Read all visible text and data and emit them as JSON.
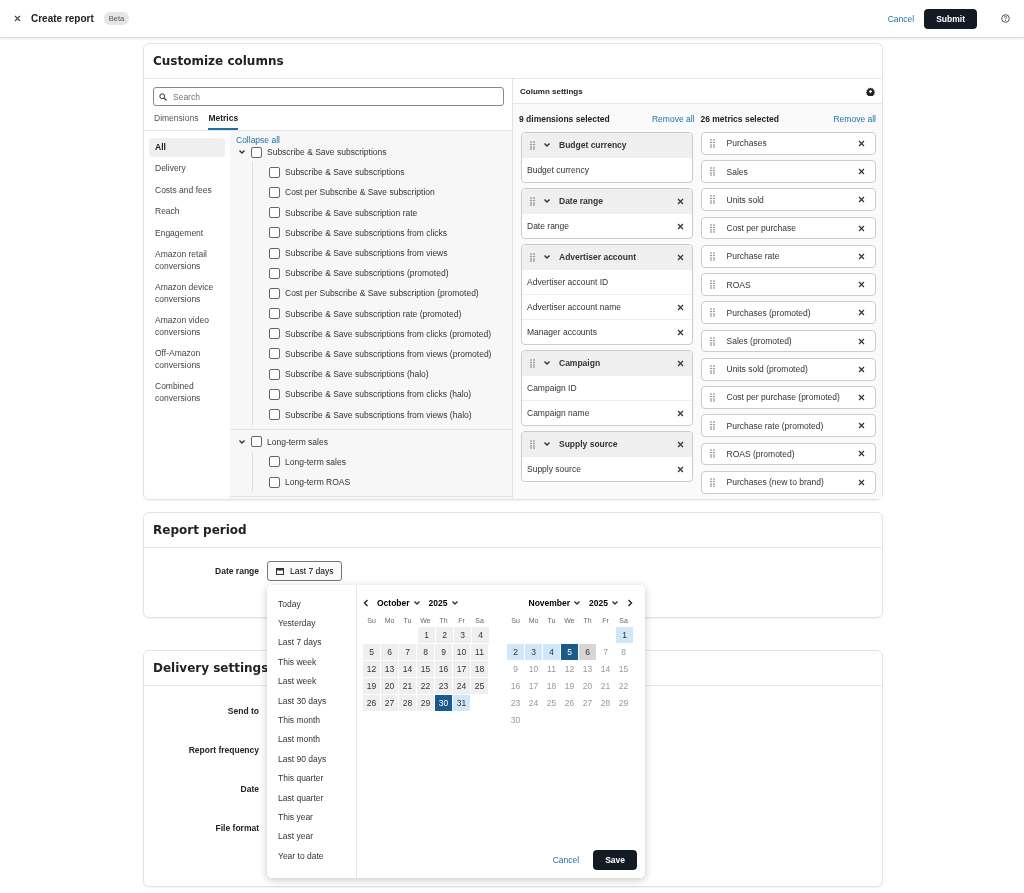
{
  "header": {
    "title": "Create report",
    "badge": "Beta",
    "cancel": "Cancel",
    "submit": "Submit"
  },
  "customize": {
    "title": "Customize columns",
    "search": {
      "placeholder": "Search"
    },
    "tabs": [
      {
        "label": "Dimensions",
        "selected": false
      },
      {
        "label": "Metrics",
        "selected": true
      }
    ],
    "nav": [
      {
        "label": "All",
        "selected": true
      },
      {
        "label": "Delivery",
        "selected": false
      },
      {
        "label": "Costs and fees",
        "selected": false
      },
      {
        "label": "Reach",
        "selected": false
      },
      {
        "label": "Engagement",
        "selected": false
      },
      {
        "label": "Amazon retail conversions",
        "selected": false
      },
      {
        "label": "Amazon device conversions",
        "selected": false
      },
      {
        "label": "Amazon video conversions",
        "selected": false
      },
      {
        "label": "Off-Amazon conversions",
        "selected": false
      },
      {
        "label": "Combined conversions",
        "selected": false
      }
    ],
    "collapse_all": "Collapse all",
    "groups": [
      {
        "label": "Subscribe & Save subscriptions",
        "expanded": true,
        "checked": false,
        "children": [
          {
            "label": "Subscribe & Save subscriptions",
            "checked": false
          },
          {
            "label": "Cost per Subscribe & Save subscription",
            "checked": false
          },
          {
            "label": "Subscribe & Save subscription rate",
            "checked": false
          },
          {
            "label": "Subscribe & Save subscriptions from clicks",
            "checked": false
          },
          {
            "label": "Subscribe & Save subscriptions from views",
            "checked": false
          },
          {
            "label": "Subscribe & Save subscriptions (promoted)",
            "checked": false
          },
          {
            "label": "Cost per Subscribe & Save subscription (promoted)",
            "checked": false
          },
          {
            "label": "Subscribe & Save subscription rate (promoted)",
            "checked": false
          },
          {
            "label": "Subscribe & Save subscriptions from clicks (promoted)",
            "checked": false
          },
          {
            "label": "Subscribe & Save subscriptions from views (promoted)",
            "checked": false
          },
          {
            "label": "Subscribe & Save subscriptions (halo)",
            "checked": false
          },
          {
            "label": "Subscribe & Save subscriptions from clicks (halo)",
            "checked": false
          },
          {
            "label": "Subscribe & Save subscriptions from views (halo)",
            "checked": false
          }
        ]
      },
      {
        "label": "Long-term sales",
        "expanded": true,
        "checked": false,
        "children": [
          {
            "label": "Long-term sales",
            "checked": false
          },
          {
            "label": "Long-term ROAS",
            "checked": false
          }
        ]
      }
    ],
    "column_settings": {
      "title": "Column settings",
      "dimensions": {
        "summary": "9 dimensions selected",
        "remove_all": "Remove all",
        "groups": [
          {
            "label": "Budget currency",
            "removable": false,
            "items": [
              {
                "label": "Budget currency",
                "removable": false
              }
            ]
          },
          {
            "label": "Date range",
            "removable": true,
            "items": [
              {
                "label": "Date range",
                "removable": true
              }
            ]
          },
          {
            "label": "Advertiser account",
            "removable": true,
            "items": [
              {
                "label": "Advertiser account ID",
                "removable": false
              },
              {
                "label": "Advertiser account name",
                "removable": true
              },
              {
                "label": "Manager accounts",
                "removable": true
              }
            ]
          },
          {
            "label": "Campaign",
            "removable": true,
            "items": [
              {
                "label": "Campaign ID",
                "removable": false
              },
              {
                "label": "Campaign name",
                "removable": true
              }
            ]
          },
          {
            "label": "Supply source",
            "removable": true,
            "items": [
              {
                "label": "Supply source",
                "removable": true
              }
            ]
          }
        ]
      },
      "metrics": {
        "summary": "26 metrics selected",
        "remove_all": "Remove all",
        "items": [
          "Purchases",
          "Sales",
          "Units sold",
          "Cost per purchase",
          "Purchase rate",
          "ROAS",
          "Purchases (promoted)",
          "Sales (promoted)",
          "Units sold (promoted)",
          "Cost per purchase (promoted)",
          "Purchase rate (promoted)",
          "ROAS (promoted)",
          "Purchases (new to brand)"
        ]
      }
    }
  },
  "report_period": {
    "title": "Report period",
    "date_range_label": "Date range",
    "date_range_value": "Last 7 days",
    "picker": {
      "presets": [
        "Today",
        "Yesterday",
        "Last 7 days",
        "This week",
        "Last week",
        "Last 30 days",
        "This month",
        "Last month",
        "Last 90 days",
        "This quarter",
        "Last quarter",
        "This year",
        "Last year",
        "Year to date"
      ],
      "months": [
        {
          "month": "October",
          "year": "2025",
          "weekdays": [
            "Su",
            "Mo",
            "Tu",
            "We",
            "Th",
            "Fr",
            "Sa"
          ],
          "weeks": [
            [
              {
                "day": "1",
                "kind": "available",
                "selected": false
              },
              {
                "day": "2",
                "kind": "available",
                "selected": false
              },
              {
                "day": "3",
                "kind": "available",
                "selected": false
              },
              {
                "day": "4",
                "kind": "available",
                "selected": false
              }
            ],
            [
              {
                "day": "5",
                "kind": "available",
                "selected": false
              },
              {
                "day": "6",
                "kind": "available",
                "selected": false
              },
              {
                "day": "7",
                "kind": "available",
                "selected": false
              },
              {
                "day": "8",
                "kind": "available",
                "selected": false
              },
              {
                "day": "9",
                "kind": "available",
                "selected": false
              },
              {
                "day": "10",
                "kind": "available",
                "selected": false
              },
              {
                "day": "11",
                "kind": "available",
                "selected": false
              }
            ],
            [
              {
                "day": "12",
                "kind": "available",
                "selected": false
              },
              {
                "day": "13",
                "kind": "available",
                "selected": false
              },
              {
                "day": "14",
                "kind": "available",
                "selected": false
              },
              {
                "day": "15",
                "kind": "available",
                "selected": false
              },
              {
                "day": "16",
                "kind": "available",
                "selected": false
              },
              {
                "day": "17",
                "kind": "available",
                "selected": false
              },
              {
                "day": "18",
                "kind": "available",
                "selected": false
              }
            ],
            [
              {
                "day": "19",
                "kind": "available",
                "selected": false
              },
              {
                "day": "20",
                "kind": "available",
                "selected": false
              },
              {
                "day": "21",
                "kind": "available",
                "selected": false
              },
              {
                "day": "22",
                "kind": "available",
                "selected": false
              },
              {
                "day": "23",
                "kind": "available",
                "selected": false
              },
              {
                "day": "24",
                "kind": "available",
                "selected": false
              },
              {
                "day": "25",
                "kind": "available",
                "selected": false
              }
            ],
            [
              {
                "day": "26",
                "kind": "available",
                "selected": false
              },
              {
                "day": "27",
                "kind": "available",
                "selected": false
              },
              {
                "day": "28",
                "kind": "available",
                "selected": false
              },
              {
                "day": "29",
                "kind": "available",
                "selected": false
              },
              {
                "day": "30",
                "kind": "in_range",
                "selected": true
              },
              {
                "day": "31",
                "kind": "in_range",
                "selected": false
              }
            ]
          ]
        },
        {
          "month": "November",
          "year": "2025",
          "weekdays": [
            "Su",
            "Mo",
            "Tu",
            "We",
            "Th",
            "Fr",
            "Sa"
          ],
          "weeks": [
            [
              {
                "day": "1",
                "kind": "in_range",
                "selected": false
              }
            ],
            [
              {
                "day": "2",
                "kind": "in_range",
                "selected": false
              },
              {
                "day": "3",
                "kind": "in_range",
                "selected": false
              },
              {
                "day": "4",
                "kind": "in_range",
                "selected": false
              },
              {
                "day": "5",
                "kind": "in_range",
                "selected": true
              },
              {
                "day": "6",
                "kind": "today",
                "selected": false
              },
              {
                "day": "7",
                "kind": "unavailable",
                "selected": false
              },
              {
                "day": "8",
                "kind": "unavailable",
                "selected": false
              }
            ],
            [
              {
                "day": "9",
                "kind": "unavailable",
                "selected": false
              },
              {
                "day": "10",
                "kind": "unavailable",
                "selected": false
              },
              {
                "day": "11",
                "kind": "unavailable",
                "selected": false
              },
              {
                "day": "12",
                "kind": "unavailable",
                "selected": false
              },
              {
                "day": "13",
                "kind": "unavailable",
                "selected": false
              },
              {
                "day": "14",
                "kind": "unavailable",
                "selected": false
              },
              {
                "day": "15",
                "kind": "unavailable",
                "selected": false
              }
            ],
            [
              {
                "day": "16",
                "kind": "unavailable",
                "selected": false
              },
              {
                "day": "17",
                "kind": "unavailable",
                "selected": false
              },
              {
                "day": "18",
                "kind": "unavailable",
                "selected": false
              },
              {
                "day": "19",
                "kind": "unavailable",
                "selected": false
              },
              {
                "day": "20",
                "kind": "unavailable",
                "selected": false
              },
              {
                "day": "21",
                "kind": "unavailable",
                "selected": false
              },
              {
                "day": "22",
                "kind": "unavailable",
                "selected": false
              }
            ],
            [
              {
                "day": "23",
                "kind": "unavailable",
                "selected": false
              },
              {
                "day": "24",
                "kind": "unavailable",
                "selected": false
              },
              {
                "day": "25",
                "kind": "unavailable",
                "selected": false
              },
              {
                "day": "26",
                "kind": "unavailable",
                "selected": false
              },
              {
                "day": "27",
                "kind": "unavailable",
                "selected": false
              },
              {
                "day": "28",
                "kind": "unavailable",
                "selected": false
              },
              {
                "day": "29",
                "kind": "unavailable",
                "selected": false
              }
            ],
            [
              {
                "day": "30",
                "kind": "unavailable",
                "selected": false
              }
            ]
          ]
        }
      ],
      "cancel": "Cancel",
      "save": "Save"
    }
  },
  "delivery": {
    "title": "Delivery settings",
    "fields": [
      "Send to",
      "Report frequency",
      "Date",
      "File format"
    ]
  }
}
